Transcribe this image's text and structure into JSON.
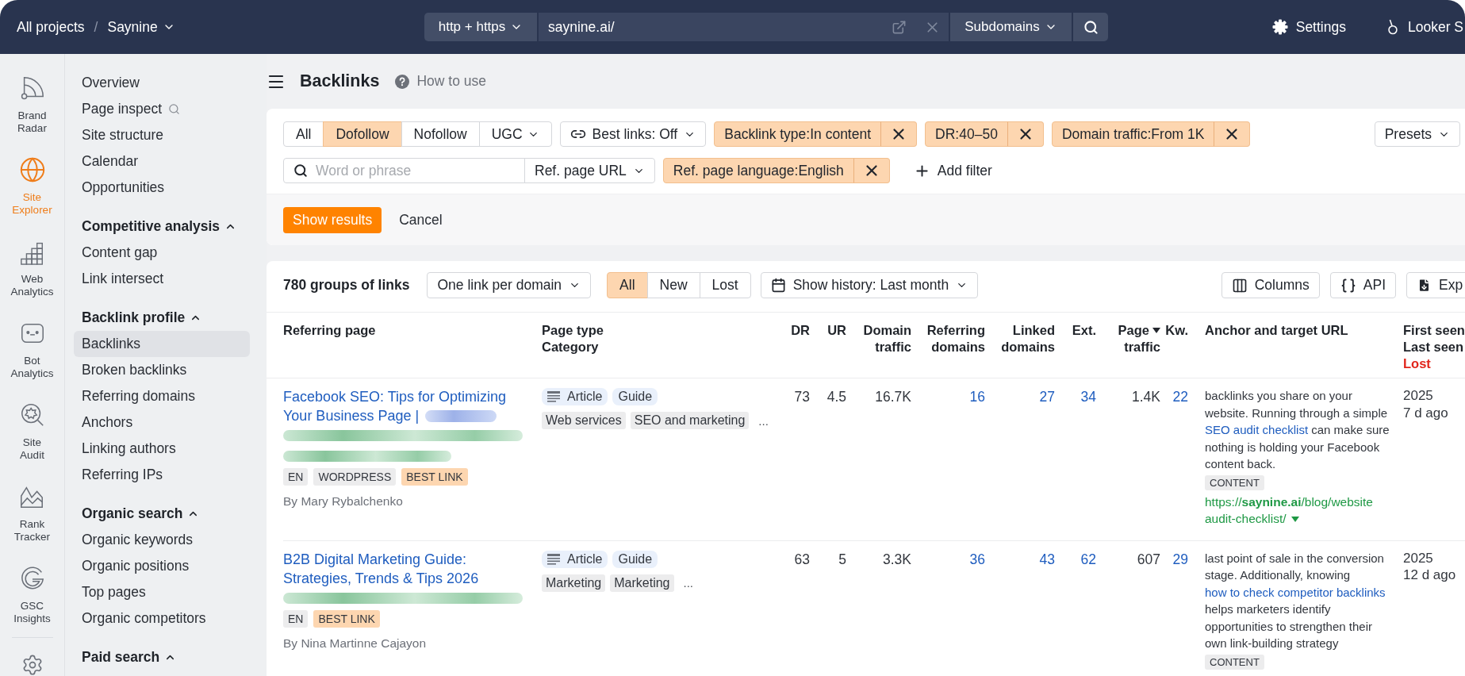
{
  "top_bar": {
    "breadcrumb": {
      "root": "All projects",
      "separator": "/",
      "project": "Saynine"
    },
    "protocol": "http + https",
    "url": "saynine.ai/",
    "scope": "Subdomains",
    "links": [
      "Settings",
      "Looker S"
    ]
  },
  "rail": {
    "items": [
      {
        "label": [
          "Brand",
          "Radar"
        ],
        "selected": false
      },
      {
        "label": [
          "Site",
          "Explorer"
        ],
        "selected": true
      },
      {
        "label": [
          "Web",
          "Analytics"
        ],
        "selected": false
      },
      {
        "label": [
          "Bot",
          "Analytics"
        ],
        "selected": false
      },
      {
        "label": [
          "Site",
          "Audit"
        ],
        "selected": false
      },
      {
        "label": [
          "Rank",
          "Tracker"
        ],
        "selected": false
      },
      {
        "label": [
          "GSC",
          "Insights"
        ],
        "selected": false
      }
    ]
  },
  "sidebar": {
    "groups": [
      {
        "items": [
          {
            "label": "Overview",
            "kind": "page",
            "selected": false
          },
          {
            "label": "Page inspect",
            "kind": "search",
            "selected": false
          },
          {
            "label": "Site structure",
            "kind": "page",
            "selected": false
          },
          {
            "label": "Calendar",
            "kind": "page",
            "selected": false
          },
          {
            "label": "Opportunities",
            "kind": "page",
            "selected": false
          }
        ]
      },
      {
        "title": "Competitive analysis",
        "expanded": true,
        "items": [
          {
            "label": "Content gap",
            "kind": "page",
            "selected": false
          },
          {
            "label": "Link intersect",
            "kind": "page",
            "selected": false
          }
        ]
      },
      {
        "title": "Backlink profile",
        "expanded": true,
        "items": [
          {
            "label": "Backlinks",
            "kind": "page",
            "selected": true
          },
          {
            "label": "Broken backlinks",
            "kind": "page",
            "selected": false
          },
          {
            "label": "Referring domains",
            "kind": "page",
            "selected": false
          },
          {
            "label": "Anchors",
            "kind": "page",
            "selected": false
          },
          {
            "label": "Linking authors",
            "kind": "page",
            "selected": false
          },
          {
            "label": "Referring IPs",
            "kind": "page",
            "selected": false
          }
        ]
      },
      {
        "title": "Organic search",
        "expanded": true,
        "items": [
          {
            "label": "Organic keywords",
            "kind": "page",
            "selected": false
          },
          {
            "label": "Organic positions",
            "kind": "page",
            "selected": false
          },
          {
            "label": "Top pages",
            "kind": "page",
            "selected": false
          },
          {
            "label": "Organic competitors",
            "kind": "page",
            "selected": false
          }
        ]
      },
      {
        "title": "Paid search",
        "expanded": true
      }
    ]
  },
  "page_header": {
    "title": "Backlinks",
    "help": "How to use"
  },
  "filters": {
    "follow": [
      {
        "label": "All",
        "selected": false
      },
      {
        "label": "Dofollow",
        "selected": true
      },
      {
        "label": "Nofollow",
        "selected": false
      }
    ],
    "ugc": "UGC",
    "best_links": "Best links: Off",
    "active": [
      "Backlink type:In content",
      "DR:40–50",
      "Domain traffic:From 1K"
    ],
    "presets": "Presets",
    "search": {
      "placeholder": "Word or phrase"
    },
    "ref_page_url": "Ref. page URL",
    "active_row_2": [
      "Ref. page language:English"
    ],
    "add_filter": "Add filter",
    "apply": "Show results",
    "cancel": "Cancel"
  },
  "table": {
    "toolbar": {
      "count": "780 groups of links",
      "grouping": "One link per domain",
      "period": [
        {
          "label": "All",
          "selected": true
        },
        {
          "label": "New",
          "selected": false
        },
        {
          "label": "Lost",
          "selected": false
        }
      ],
      "history": "Show history: Last month",
      "actions": [
        "Columns",
        "API",
        "Exp"
      ]
    },
    "columns": [
      {
        "lines": [
          "Referring page"
        ],
        "kind": "text",
        "sorted": false
      },
      {
        "lines": [
          "Page type",
          "Category"
        ],
        "kind": "text",
        "sorted": false
      },
      {
        "lines": [
          "DR"
        ],
        "kind": "number",
        "sorted": false
      },
      {
        "lines": [
          "UR"
        ],
        "kind": "number",
        "sorted": false
      },
      {
        "lines": [
          "Domain",
          "traffic"
        ],
        "kind": "number",
        "sorted": false
      },
      {
        "lines": [
          "Referring",
          "domains"
        ],
        "kind": "link",
        "sorted": false
      },
      {
        "lines": [
          "Linked",
          "domains"
        ],
        "kind": "link",
        "sorted": false
      },
      {
        "lines": [
          "Ext."
        ],
        "kind": "link",
        "sorted": false
      },
      {
        "lines": [
          "Page",
          "traffic"
        ],
        "kind": "number",
        "sorted": true
      },
      {
        "lines": [
          "Kw."
        ],
        "kind": "link",
        "sorted": false
      },
      {
        "lines": [
          "Anchor and target URL"
        ],
        "kind": "text",
        "sorted": false
      },
      {
        "lines": [
          "First seen",
          "Last seen"
        ],
        "kind": "text",
        "sorted": false,
        "note": "Lost"
      }
    ],
    "rows": [
      {
        "title": "Facebook SEO: Tips for Optimizing Your Business Page |",
        "title_redacted": true,
        "url_redacted": [
          {
            "kind": "wide"
          },
          {
            "kind": "medium"
          }
        ],
        "tags": [
          {
            "label": "EN",
            "highlighted": false
          },
          {
            "label": "WORDPRESS",
            "highlighted": false
          },
          {
            "label": "BEST LINK",
            "highlighted": true
          }
        ],
        "author": "By Mary Rybalchenko",
        "page_types": [
          {
            "label": "Article",
            "kind": "icon"
          },
          {
            "label": "Guide",
            "kind": "plain"
          }
        ],
        "categories": [
          "Web services",
          "SEO and marketing"
        ],
        "more": "...",
        "metrics": [
          "73",
          "4.5",
          "16.7K",
          "16",
          "27",
          "34",
          "1.4K",
          "22"
        ],
        "anchor": [
          {
            "text": "backlinks you share on your website. Running through a simple ",
            "kind": "text"
          },
          {
            "text": "SEO audit checklist",
            "kind": "link"
          },
          {
            "text": " can make sure nothing is holding your Facebook content back.",
            "kind": "text"
          }
        ],
        "anchor_tag": "CONTENT",
        "target_url": [
          "https://**saynine.ai**/blog/website",
          "audit-checklist/"
        ],
        "first_seen": "2025",
        "last_seen": "7 d ago"
      },
      {
        "title": "B2B Digital Marketing Guide: Strategies, Trends & Tips 2026",
        "title_redacted": false,
        "url_redacted": [
          {
            "kind": "wide"
          }
        ],
        "tags": [
          {
            "label": "EN",
            "highlighted": false
          },
          {
            "label": "BEST LINK",
            "highlighted": true
          }
        ],
        "author": "By Nina Martinne Cajayon",
        "page_types": [
          {
            "label": "Article",
            "kind": "icon"
          },
          {
            "label": "Guide",
            "kind": "plain"
          }
        ],
        "categories": [
          "Marketing",
          "Marketing"
        ],
        "more": "...",
        "metrics": [
          "63",
          "5",
          "3.3K",
          "36",
          "43",
          "62",
          "607",
          "29"
        ],
        "anchor": [
          {
            "text": "last point of sale in the conversion stage. Additionally, knowing ",
            "kind": "text"
          },
          {
            "text": "how to check competitor backlinks",
            "kind": "link"
          },
          {
            "text": " helps marketers identify opportunities to strengthen their own link-building strategy",
            "kind": "text"
          }
        ],
        "anchor_tag": "CONTENT",
        "first_seen": "2025",
        "last_seen": "12 d ago"
      }
    ]
  }
}
